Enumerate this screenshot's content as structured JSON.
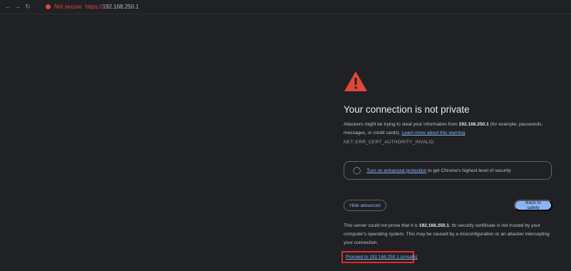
{
  "browser": {
    "not_secure": "Not secure",
    "url_scheme": "https://",
    "url_host": "192.168.250.1"
  },
  "interstitial": {
    "heading": "Your connection is not private",
    "desc_pre": "Attackers might be trying to steal your information from ",
    "desc_host": "192.168.250.1",
    "desc_mid": " (for example, passwords, messages, or credit cards). ",
    "learn_more": "Learn more about this warning",
    "error_code": "NET::ERR_CERT_AUTHORITY_INVALID",
    "enhanced_link": "Turn on enhanced protection",
    "enhanced_rest": " to get Chrome's highest level of security",
    "hide_advanced": "Hide advanced",
    "back_to_safety": "Back to safety",
    "adv_pre": "This server could not prove that it is ",
    "adv_host": "192.168.250.1",
    "adv_post": "; its security certificate is not trusted by your computer's operating system. This may be caused by a misconfiguration or an attacker intercepting your connection.",
    "proceed": "Proceed to 192.168.250.1 (unsafe)"
  },
  "colors": {
    "background": "#202124",
    "warning_red": "#e0473b",
    "link_blue": "#8ab4f8",
    "highlight_box": "#e02b2b"
  }
}
